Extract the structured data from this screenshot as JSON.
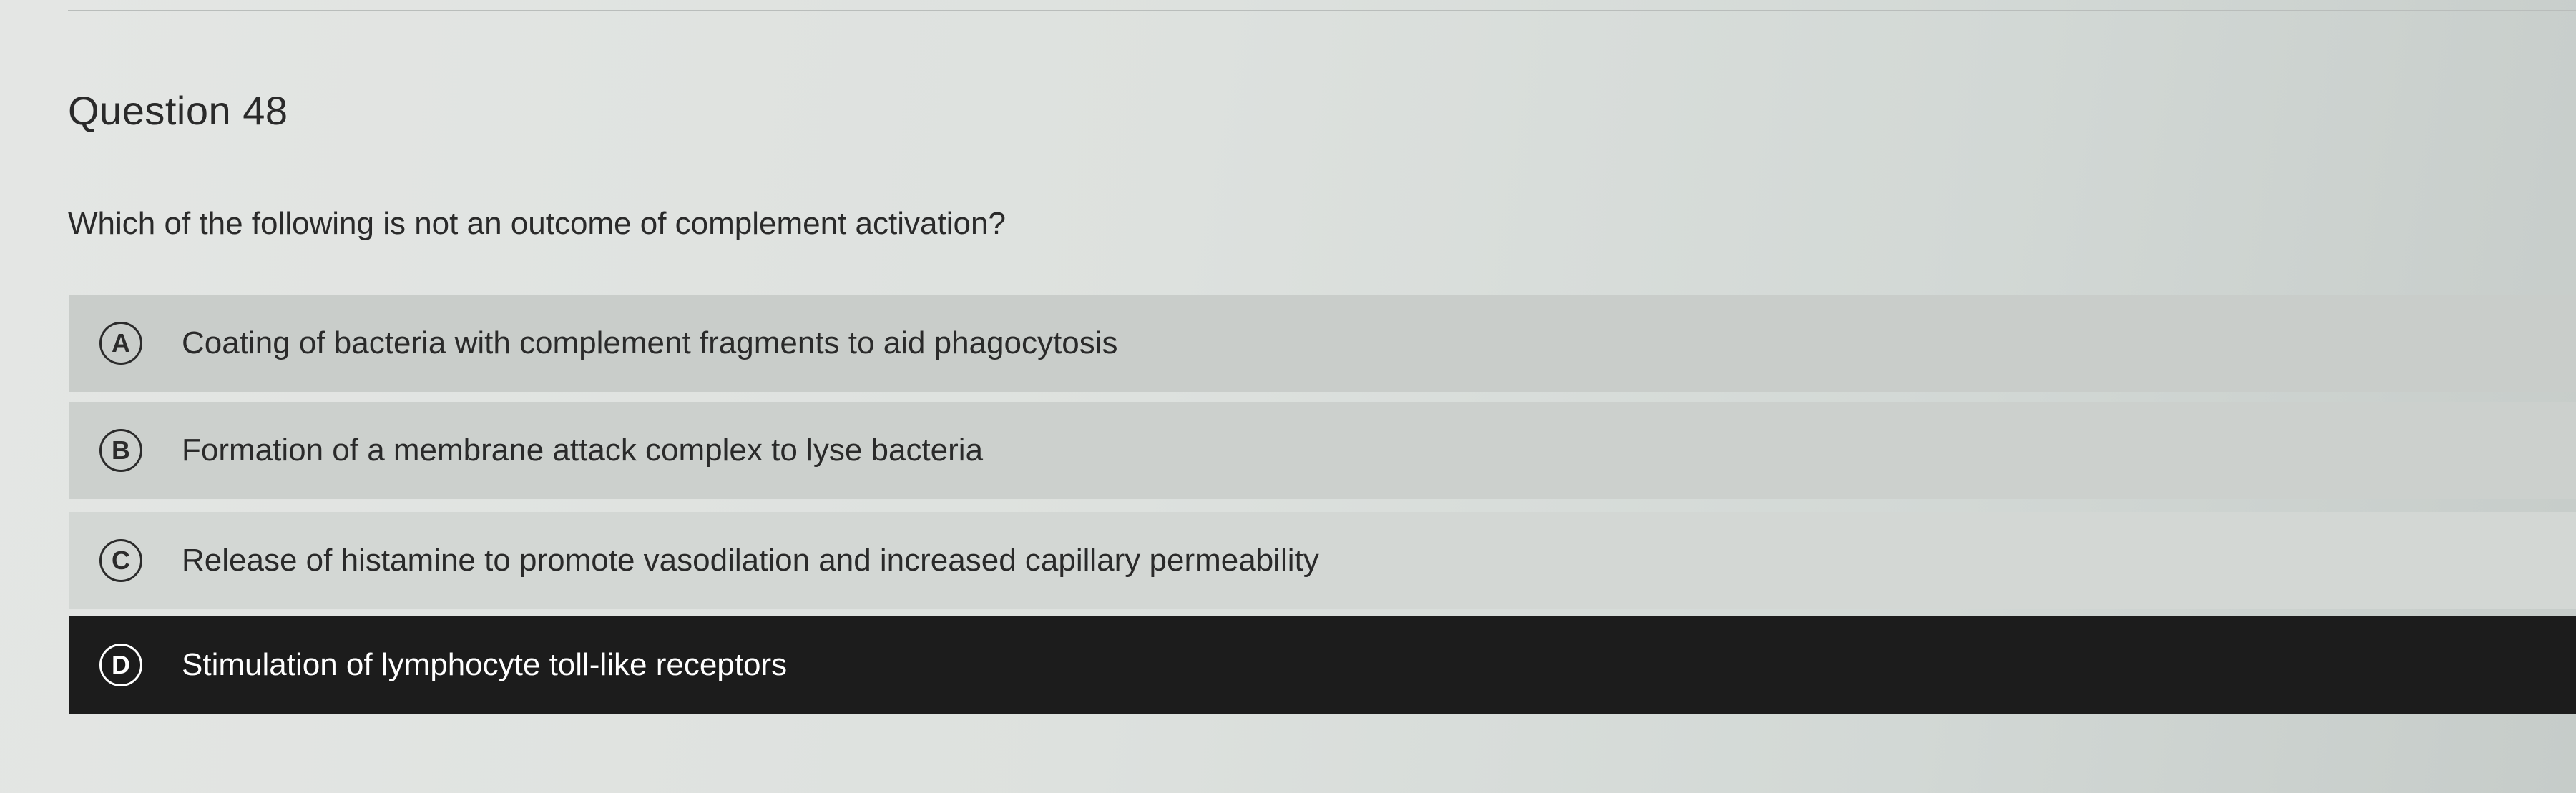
{
  "question": {
    "title": "Question 48",
    "text": "Which of the following is not an outcome of complement activation?"
  },
  "options": [
    {
      "letter": "A",
      "text": "Coating of bacteria with complement fragments to aid phagocytosis",
      "selected": false
    },
    {
      "letter": "B",
      "text": "Formation of a membrane attack complex to lyse bacteria",
      "selected": false
    },
    {
      "letter": "C",
      "text": "Release of histamine to promote vasodilation and increased capillary permeability",
      "selected": false
    },
    {
      "letter": "D",
      "text": "Stimulation of lymphocyte toll-like receptors",
      "selected": true
    }
  ],
  "colors": {
    "selected_background": "#1c1c1c",
    "option_background": "#c9cdca",
    "text": "#2a2a2a"
  }
}
